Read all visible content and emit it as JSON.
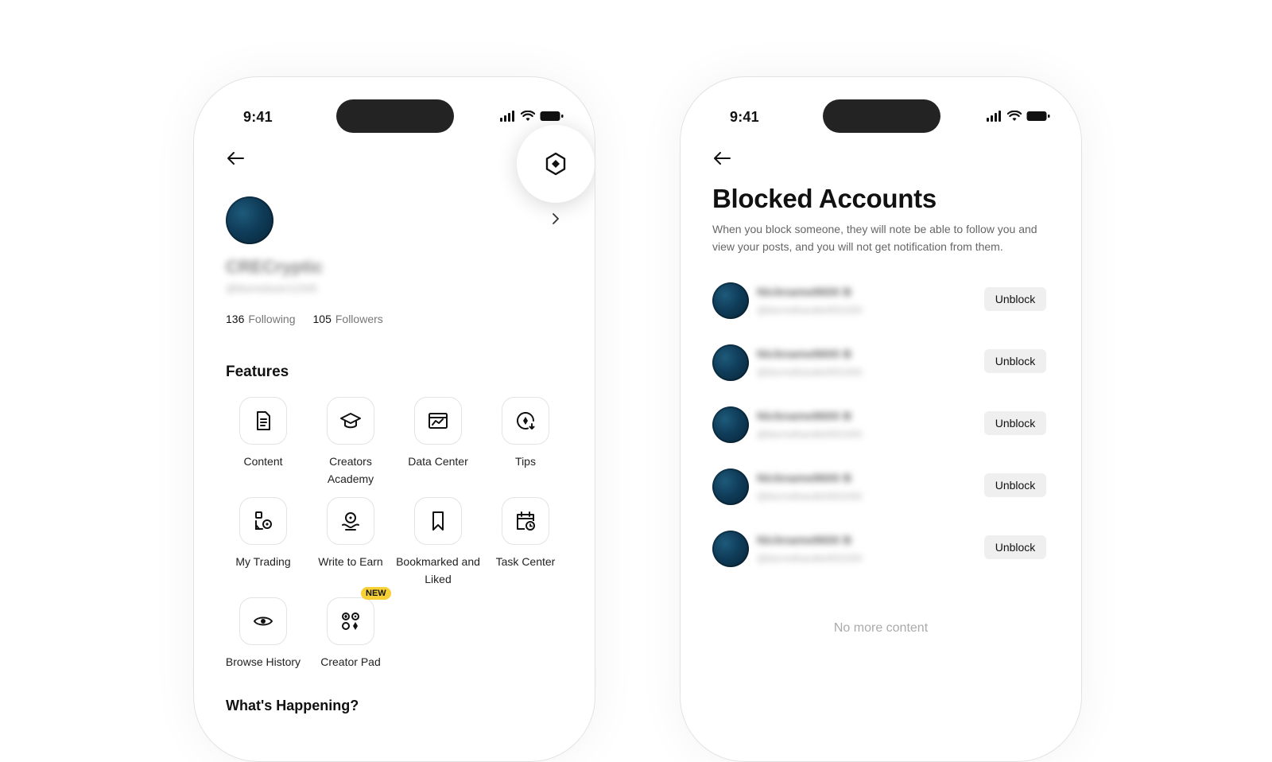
{
  "left_phone": {
    "status": {
      "time": "9:41"
    },
    "profile": {
      "name": "CRECryptic",
      "handle": "@blurreduser12345",
      "following_count": "136",
      "following_label": "Following",
      "followers_count": "105",
      "followers_label": "Followers"
    },
    "features": {
      "title": "Features",
      "items": [
        {
          "label": "Content",
          "icon": "document-icon"
        },
        {
          "label": "Creators Academy",
          "icon": "graduation-cap-icon"
        },
        {
          "label": "Data Center",
          "icon": "chart-icon"
        },
        {
          "label": "Tips",
          "icon": "tips-icon"
        },
        {
          "label": "My Trading",
          "icon": "trading-icon"
        },
        {
          "label": "Write to Earn",
          "icon": "earn-icon"
        },
        {
          "label": "Bookmarked and Liked",
          "icon": "bookmark-icon"
        },
        {
          "label": "Task Center",
          "icon": "calendar-icon"
        },
        {
          "label": "Browse History",
          "icon": "eye-icon"
        },
        {
          "label": "Creator Pad",
          "icon": "creator-pad-icon",
          "badge": "NEW"
        }
      ]
    },
    "whats_happening": "What's Happening?"
  },
  "right_phone": {
    "status": {
      "time": "9:41"
    },
    "title": "Blocked Accounts",
    "description": "When you block someone, they will note be able to follow you and view your posts, and you will not get notification from them.",
    "accounts": [
      {
        "name": "Nickname8600 B",
        "handle": "@blurredhandle0001000",
        "button": "Unblock"
      },
      {
        "name": "Nickname8600 B",
        "handle": "@blurredhandle0001000",
        "button": "Unblock"
      },
      {
        "name": "Nickname8600 B",
        "handle": "@blurredhandle0001000",
        "button": "Unblock"
      },
      {
        "name": "Nickname8600 B",
        "handle": "@blurredhandle0001000",
        "button": "Unblock"
      },
      {
        "name": "Nickname8600 B",
        "handle": "@blurredhandle0001000",
        "button": "Unblock"
      }
    ],
    "footer": "No more content"
  },
  "colors": {
    "badge": "#f7d036",
    "avatar": "#0f3c59",
    "unblock_bg": "#efefef"
  }
}
